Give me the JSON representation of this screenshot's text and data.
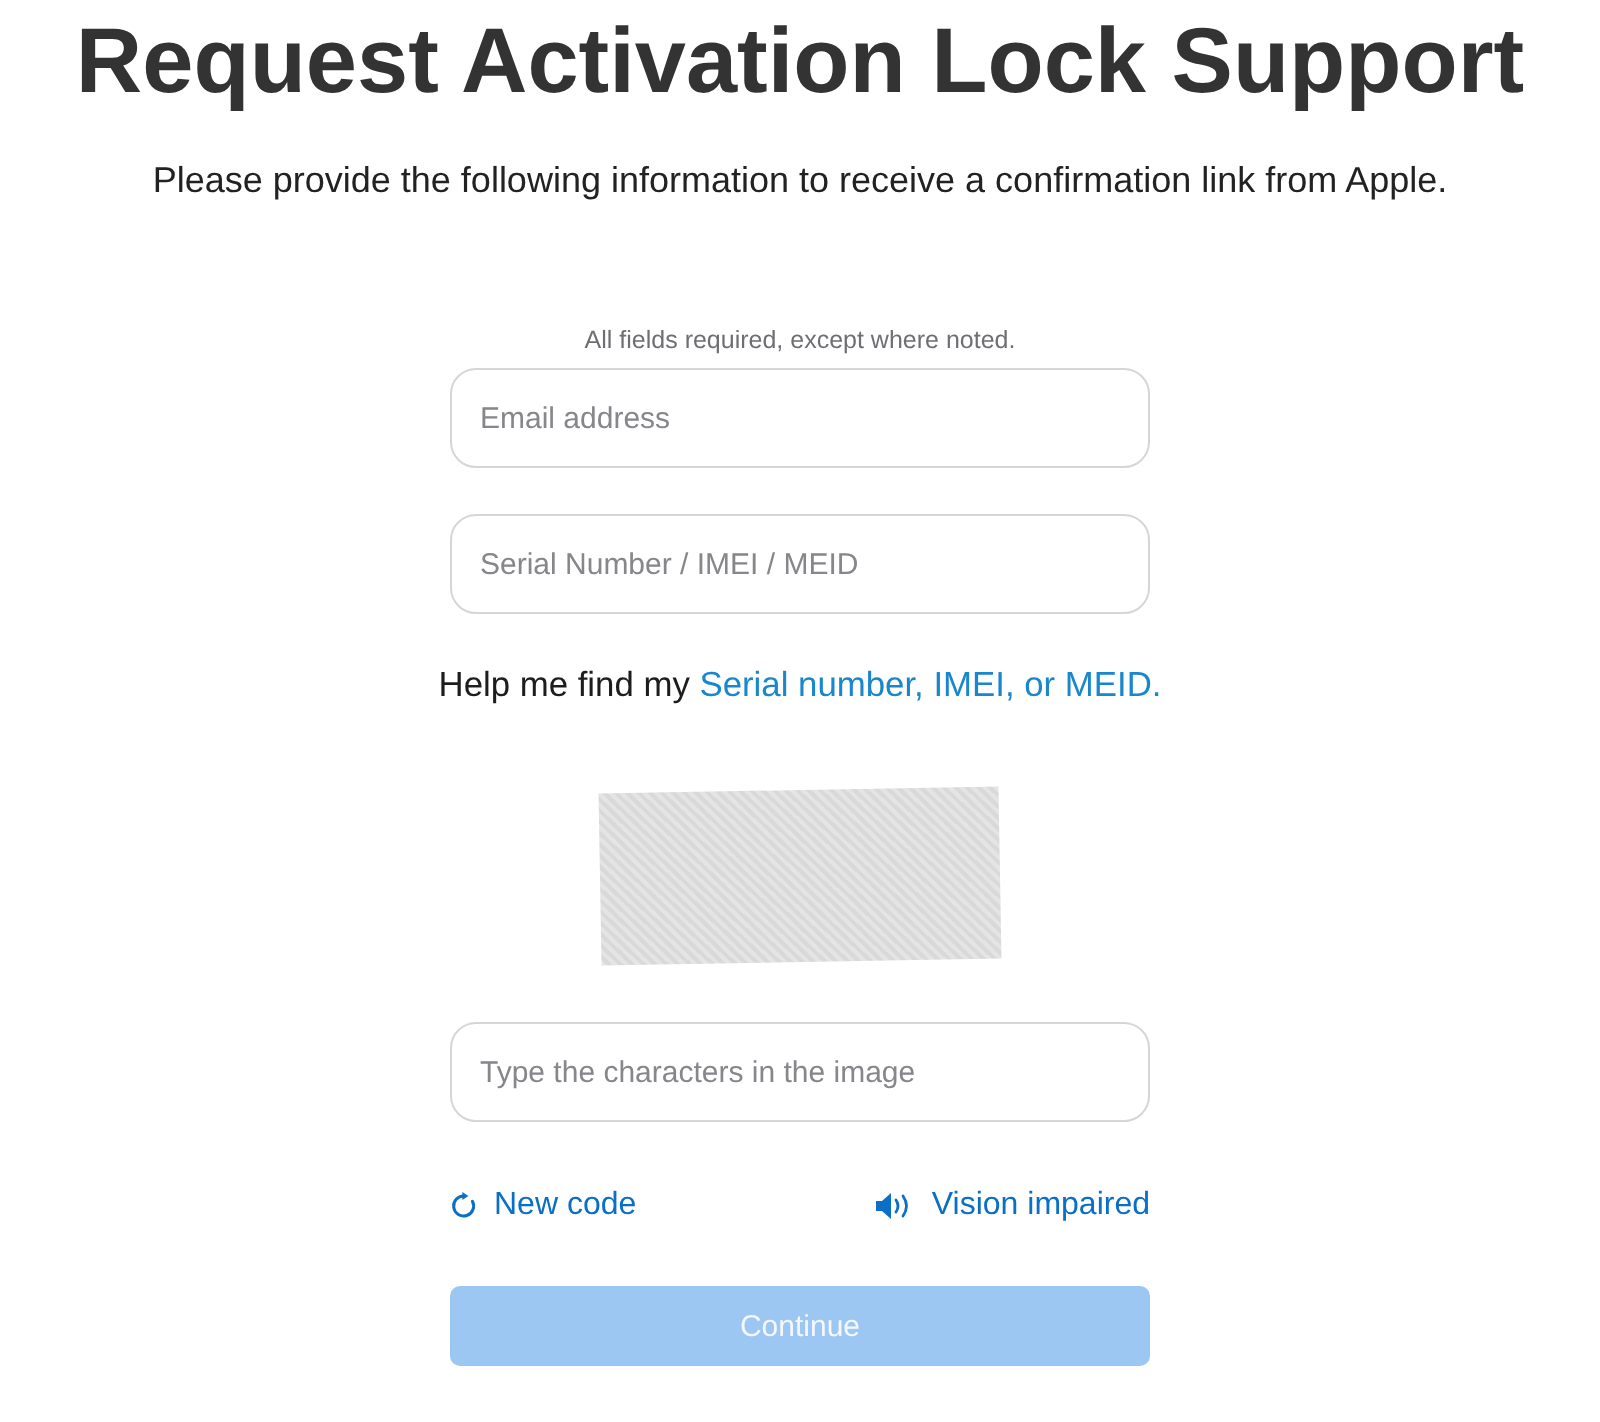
{
  "title": "Request Activation Lock Support",
  "subtitle": "Please provide the following information to receive a confirmation link from Apple.",
  "form": {
    "note": "All fields required, except where noted.",
    "fields": [
      {
        "placeholder": "Email address"
      },
      {
        "placeholder": "Serial Number / IMEI / MEID"
      }
    ],
    "help": {
      "text": "Help me find my",
      "link": "Serial number, IMEI, or MEID."
    },
    "captcha": {
      "field": {
        "placeholder": "Type the characters in the image"
      },
      "actions": [
        {
          "kind": "refresh",
          "label": "New code"
        },
        {
          "kind": "audio",
          "label": "Vision impaired"
        }
      ]
    },
    "continue_button": {
      "label": "Continue",
      "disabled": true
    }
  }
}
